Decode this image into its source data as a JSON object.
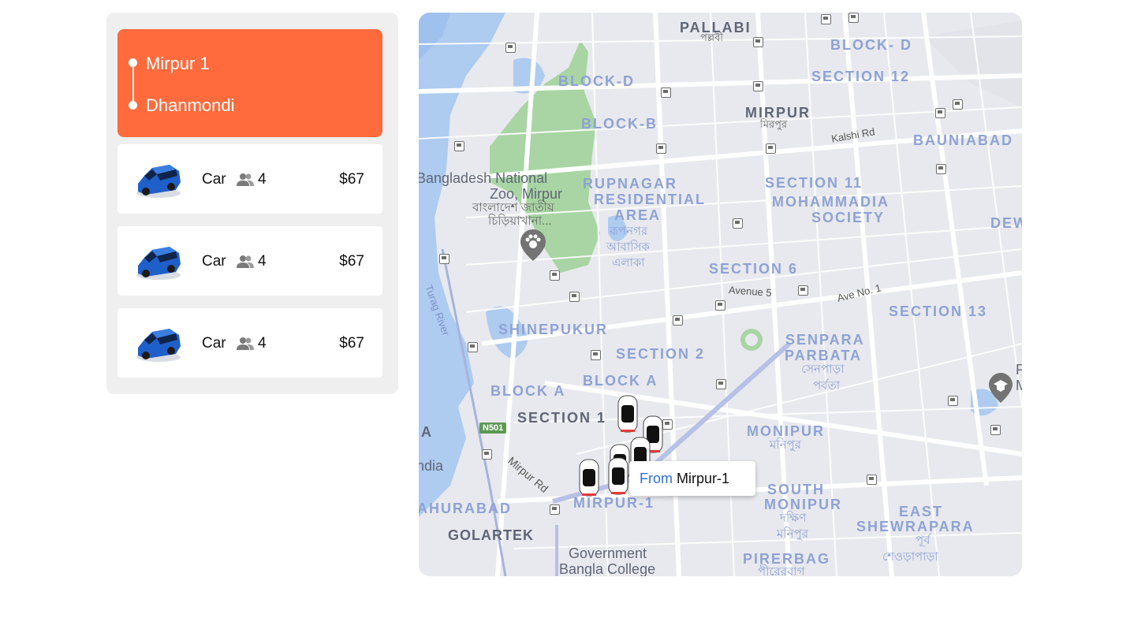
{
  "route": {
    "origin": "Mirpur 1",
    "destination": "Dhanmondi",
    "accent_color": "#ff6b3d"
  },
  "rides": [
    {
      "type": "Car",
      "seats": "4",
      "price": "$67",
      "icon": "car-icon"
    },
    {
      "type": "Car",
      "seats": "4",
      "price": "$67",
      "icon": "car-icon"
    },
    {
      "type": "Car",
      "seats": "4",
      "price": "$67",
      "icon": "car-icon"
    }
  ],
  "map": {
    "tooltip": {
      "from_label": "From",
      "place": "Mirpur-1"
    },
    "labels": {
      "pallabi": "PALLABI",
      "pallabi_bn": "পল্লবী",
      "block_d_top": "BLOCK- D",
      "section_12": "SECTION 12",
      "block_d": "BLOCK-D",
      "block_b": "BLOCK-B",
      "mirpur": "MIRPUR",
      "mirpur_bn": "মিরপুর",
      "kalshi_rd": "Kalshi Rd",
      "bauniabad": "BAUNIABAD",
      "zoo_1": "Bangladesh National",
      "zoo_2": "Zoo, Mirpur",
      "zoo_bn_1": "বাংলাদেশ জাতীয়",
      "zoo_bn_2": "চিড়িয়াখানা...",
      "rupnagar_1": "RUPNAGAR",
      "rupnagar_2": "RESIDENTIAL",
      "rupnagar_3": "AREA",
      "rupnagar_bn_1": "রূপনগর",
      "rupnagar_bn_2": "আবাসিক",
      "rupnagar_bn_3": "এলাকা",
      "section_11": "SECTION 11",
      "mohammadia_1": "MOHAMMADIA",
      "mohammadia_2": "SOCIETY",
      "dew": "DEW",
      "section_6": "SECTION 6",
      "avenue_5": "Avenue 5",
      "ave_no_1": "Ave No. 1",
      "section_13": "SECTION 13",
      "turag_river": "Turag River",
      "shinepukur": "SHINEPUKUR",
      "section_2": "SECTION 2",
      "senpara_1": "SENPARA",
      "senpara_2": "PARBATA",
      "senpara_bn_1": "সেনপাড়া",
      "senpara_bn_2": "পর্বতা",
      "block_a_left": "BLOCK A",
      "block_a_right": "BLOCK A",
      "section_1": "SECTION 1",
      "n501": "N501",
      "monipur": "MONIPUR",
      "monipur_bn": "মনিপুর",
      "a_left": "A",
      "india": "ndia",
      "mirpur_rd": "Mirpur Rd",
      "south_monipur_1": "SOUTH",
      "south_monipur_2": "MONIPUR",
      "south_monipur_bn_1": "দক্ষিণ",
      "south_monipur_bn_2": "মনিপুর",
      "east_shewrapara_1": "EAST",
      "east_shewrapara_2": "SHEWRAPARA",
      "east_shewrapara_bn_1": "পূর্ব",
      "east_shewrapara_bn_2": "শেওড়াপাড়া",
      "ahurabad": "AHURABAD",
      "mirpur_1_label": "MIRPUR-1",
      "golartek": "GOLARTEK",
      "govt_1": "Government",
      "govt_2": "Bangla College",
      "pirerbag": "PIRERBAG",
      "pirerbag_bn": "পীরেরবাগ",
      "edge_p": "P",
      "edge_m": "M"
    }
  }
}
